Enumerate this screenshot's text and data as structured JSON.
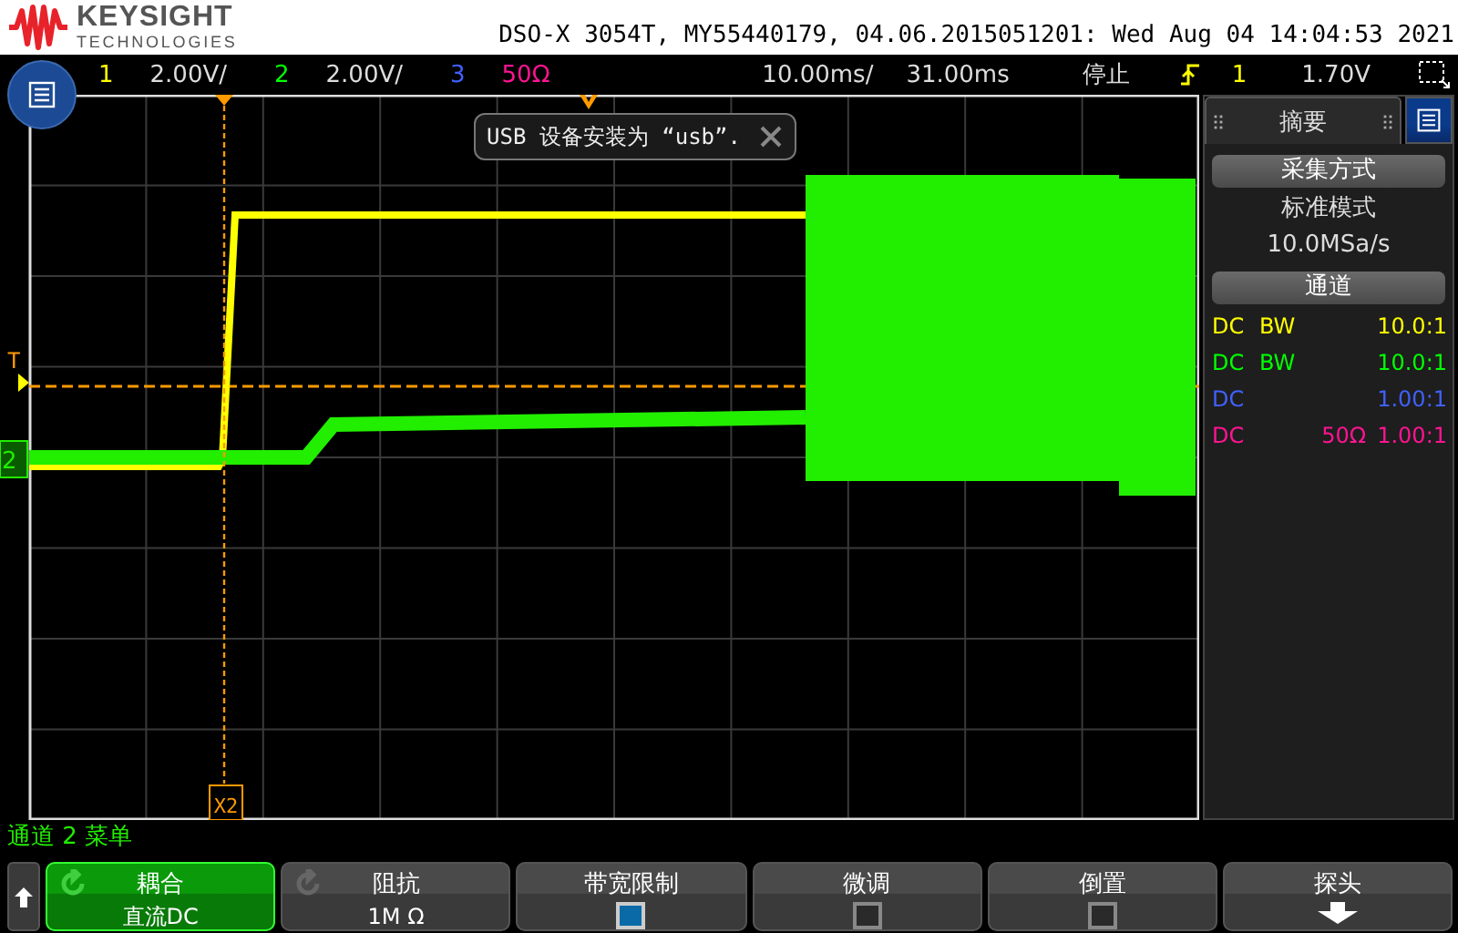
{
  "header": {
    "brand": "KEYSIGHT",
    "brand_sub": "TECHNOLOGIES",
    "title": "DSO-X 3054T, MY55440179, 04.06.2015051201: Wed Aug 04 14:04:53 2021"
  },
  "status_bar": {
    "channels": [
      {
        "number": "1",
        "scale": "2.00V/",
        "color": "#ffff00"
      },
      {
        "number": "2",
        "scale": "2.00V/",
        "color": "#00ff00"
      },
      {
        "number": "3",
        "color": "#4060ff"
      },
      {
        "number": "50Ω",
        "color": "#ff1493"
      }
    ],
    "timebase": "10.00ms/",
    "delay": "31.00ms",
    "run_state": "停止",
    "trigger_source": "1",
    "trigger_level": "1.70V"
  },
  "toast": {
    "message": "USB 设备安装为 “usb”."
  },
  "screen": {
    "trigger_label": "T",
    "channel_marker": "2",
    "cursor_label": "X2"
  },
  "side_panel": {
    "tab": "摘要",
    "acquisition": {
      "heading": "采集方式",
      "mode": "标准模式",
      "rate": "10.0MSa/s"
    },
    "channels_heading": "通道",
    "channels": [
      {
        "coupling": "DC",
        "bandwidth": "BW",
        "ratio": "10.0:1",
        "color": "#ffff00"
      },
      {
        "coupling": "DC",
        "bandwidth": "BW",
        "ratio": "10.0:1",
        "color": "#00ff00"
      },
      {
        "coupling": "DC",
        "ratio": "1.00:1",
        "color": "#4060ff"
      },
      {
        "coupling": "DC",
        "impedance": "50Ω",
        "ratio": "1.00:1",
        "color": "#ff1493"
      }
    ]
  },
  "menu": {
    "title": "通道 2 菜单",
    "softkeys": [
      {
        "kind": "value",
        "label": "耦合",
        "value": "直流DC",
        "selected": true
      },
      {
        "kind": "value",
        "label": "阻抗",
        "value": "1M Ω",
        "selected": false
      },
      {
        "kind": "checkbox",
        "label": "带宽限制",
        "checked": true
      },
      {
        "kind": "checkbox",
        "label": "微调",
        "checked": false
      },
      {
        "kind": "checkbox",
        "label": "倒置",
        "checked": false
      },
      {
        "kind": "submenu",
        "label": "探头"
      }
    ]
  }
}
